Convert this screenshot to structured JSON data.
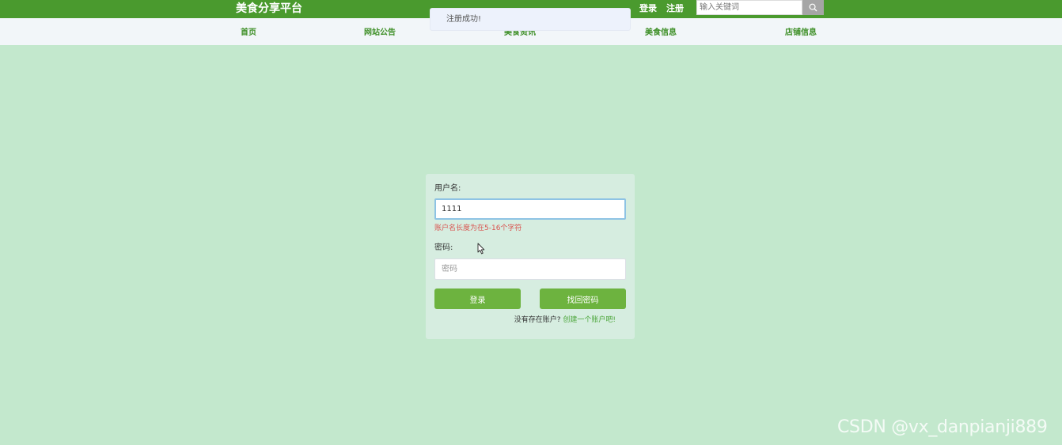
{
  "header": {
    "brand": "美食分享平台",
    "links": {
      "login": "登录",
      "register": "注册"
    },
    "search": {
      "placeholder": "输入关键词",
      "icon": "search-icon"
    }
  },
  "nav": {
    "items": [
      {
        "label": "首页"
      },
      {
        "label": "网站公告"
      },
      {
        "label": "美食资讯"
      },
      {
        "label": "美食信息"
      },
      {
        "label": "店铺信息"
      }
    ]
  },
  "toast": {
    "message": "注册成功!"
  },
  "login_form": {
    "username_label": "用户名:",
    "username_value": "1111",
    "username_error": "账户名长度为在5-16个字符",
    "password_label": "密码:",
    "password_placeholder": "密码",
    "login_button": "登录",
    "forgot_button": "找回密码",
    "no_account_text": "没有存在账户?",
    "create_account_link": "创建一个账户吧!"
  },
  "watermark": "CSDN @vx_danpianji889",
  "colors": {
    "topbar": "#4a9a2e",
    "nav_text": "#3e8f27",
    "page_bg": "#c3e8cd",
    "button": "#6db33f",
    "error": "#d9534f"
  }
}
